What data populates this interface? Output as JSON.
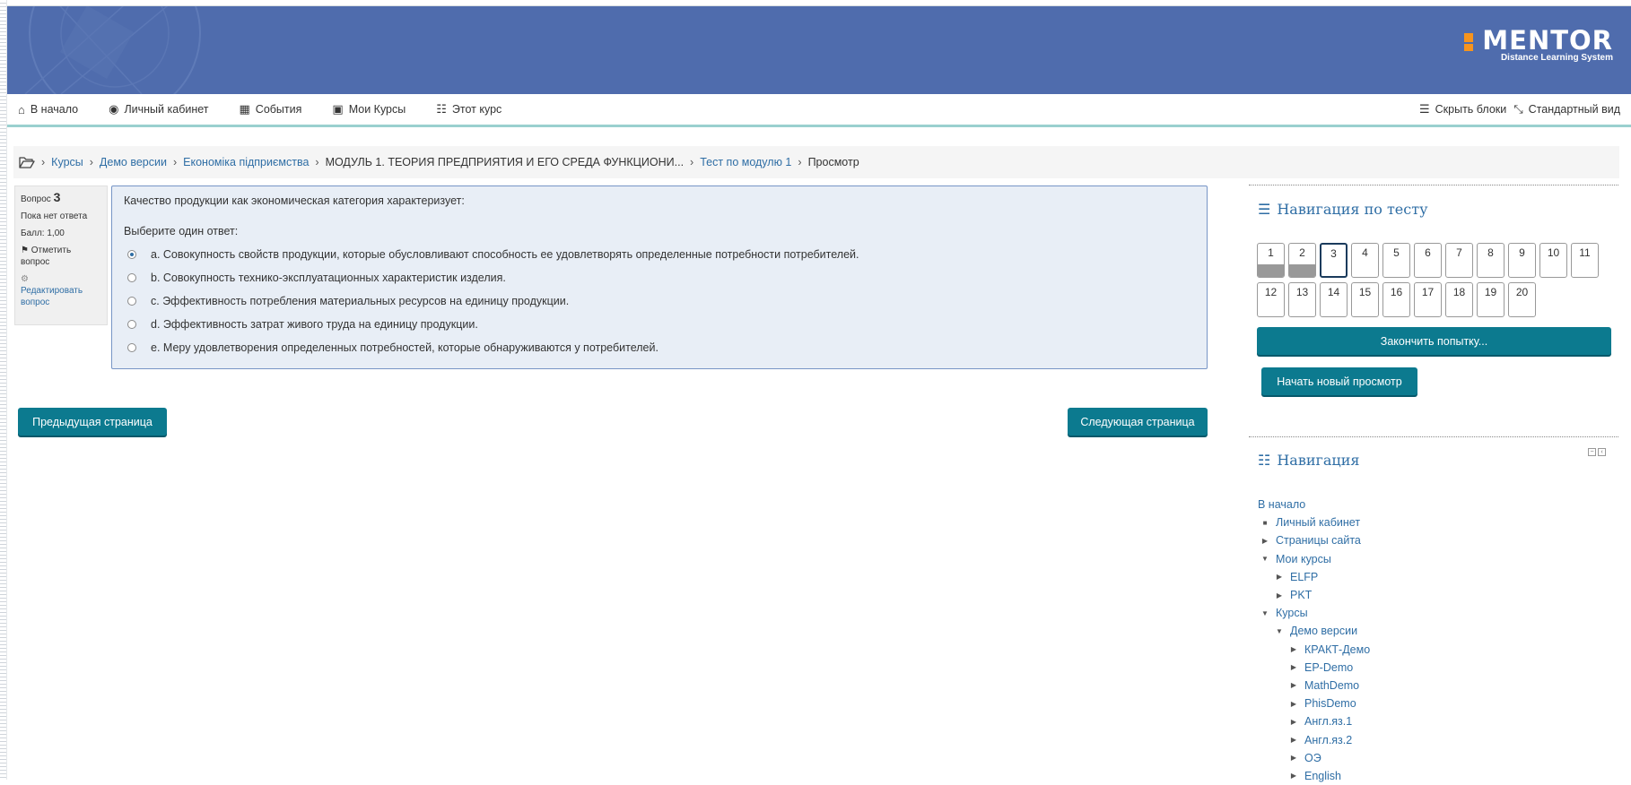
{
  "header": {
    "logo_word": "MENTOR",
    "logo_sub": "Distance Learning System"
  },
  "navbar": {
    "home": "В начало",
    "dashboard": "Личный кабинет",
    "events": "События",
    "my_courses": "Мои Курсы",
    "this_course": "Этот курс",
    "hide_blocks": "Скрыть блоки",
    "standard_view": "Стандартный вид"
  },
  "breadcrumb": {
    "items": [
      "Курсы",
      "Демо версии",
      "Економіка підприємства",
      "МОДУЛЬ 1. ТЕОРИЯ ПРЕДПРИЯТИЯ И ЕГО СРЕДА ФУНКЦИОНИ...",
      "Тест по модулю 1",
      "Просмотр"
    ]
  },
  "question_info": {
    "label": "Вопрос",
    "number": "3",
    "state": "Пока нет ответа",
    "score": "Балл: 1,00",
    "flag": "Отметить вопрос",
    "edit": "Редактировать вопрос"
  },
  "question": {
    "text": "Качество продукции как экономическая категория характеризует:",
    "prompt": "Выберите один ответ:",
    "answers": [
      "a. Совокупность свойств продукции, которые обусловливают способность ее удовлетворять определенные потребности потребителей.",
      "b. Совокупность технико-эксплуатационных характеристик изделия.",
      "c. Эффективность потребления материальных ресурсов на единицу продукции.",
      "d. Эффективность затрат живого труда на единицу продукции.",
      "e. Меру удовлетворения определенных потребностей, которые обнаруживаются у потребителей."
    ],
    "selected_index": 0
  },
  "buttons": {
    "prev": "Предыдущая страница",
    "next": "Следующая страница",
    "finish": "Закончить попытку...",
    "new_preview": "Начать новый просмотр"
  },
  "quiz_nav": {
    "title": "Навигация по тесту",
    "cells": [
      "1",
      "2",
      "3",
      "4",
      "5",
      "6",
      "7",
      "8",
      "9",
      "10",
      "11",
      "12",
      "13",
      "14",
      "15",
      "16",
      "17",
      "18",
      "19",
      "20"
    ],
    "answered": [
      1,
      2
    ],
    "current": 3
  },
  "navigation": {
    "title": "Навигация",
    "items": [
      {
        "label": "В начало",
        "level": 0,
        "marker": ""
      },
      {
        "label": "Личный кабинет",
        "level": 1,
        "marker": "square"
      },
      {
        "label": "Страницы сайта",
        "level": 1,
        "marker": "collapsed"
      },
      {
        "label": "Мои курсы",
        "level": 1,
        "marker": "expanded"
      },
      {
        "label": "ELFP",
        "level": 2,
        "marker": "collapsed"
      },
      {
        "label": "PKT",
        "level": 2,
        "marker": "collapsed"
      },
      {
        "label": "Курсы",
        "level": 1,
        "marker": "expanded"
      },
      {
        "label": "Демо версии",
        "level": 2,
        "marker": "expanded"
      },
      {
        "label": "КРАКТ-Демо",
        "level": 3,
        "marker": "collapsed"
      },
      {
        "label": "EP-Demo",
        "level": 3,
        "marker": "collapsed"
      },
      {
        "label": "MathDemo",
        "level": 3,
        "marker": "collapsed"
      },
      {
        "label": "PhisDemo",
        "level": 3,
        "marker": "collapsed"
      },
      {
        "label": "Англ.яз.1",
        "level": 3,
        "marker": "collapsed"
      },
      {
        "label": "Англ.яз.2",
        "level": 3,
        "marker": "collapsed"
      },
      {
        "label": "ОЭ",
        "level": 3,
        "marker": "collapsed"
      },
      {
        "label": "English",
        "level": 3,
        "marker": "collapsed"
      }
    ]
  },
  "colors": {
    "header_bg": "#4f6cad",
    "button": "#0c7a8f",
    "link": "#2f6ea5",
    "logo_accent": "#f7941d"
  }
}
